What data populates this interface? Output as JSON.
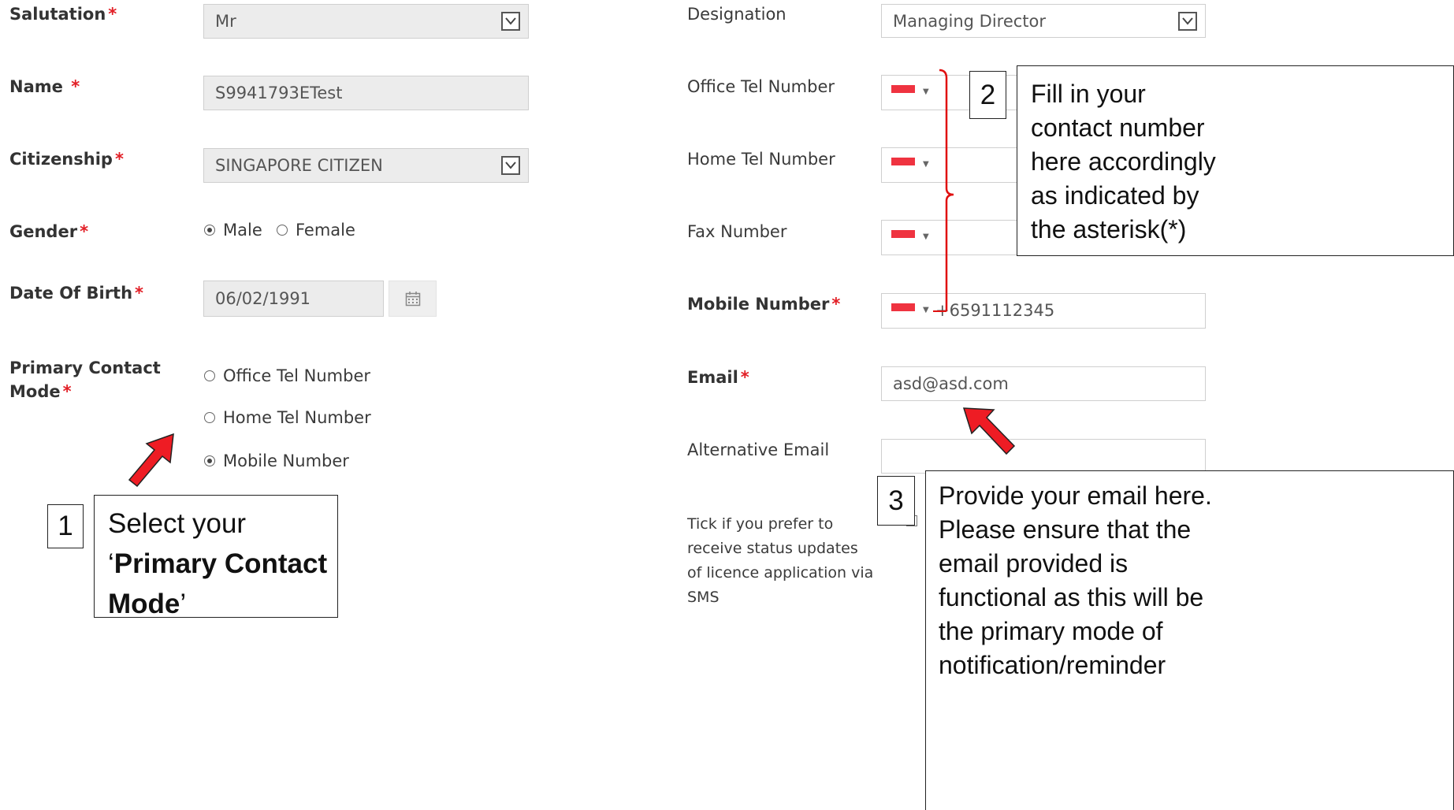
{
  "form_left": {
    "salutation": {
      "label": "Salutation",
      "value": "Mr"
    },
    "name": {
      "label": "Name",
      "value": "S9941793ETest"
    },
    "citizenship": {
      "label": "Citizenship",
      "value": "SINGAPORE CITIZEN"
    },
    "gender": {
      "label": "Gender",
      "options": [
        "Male",
        "Female"
      ],
      "selected": "Male"
    },
    "dob": {
      "label": "Date Of Birth",
      "value": "06/02/1991"
    },
    "primary_contact_mode": {
      "label_line1": "Primary Contact",
      "label_line2": "Mode",
      "options": [
        "Office Tel Number",
        "Home Tel Number",
        "Mobile Number"
      ],
      "selected": "Mobile Number"
    }
  },
  "form_right": {
    "designation": {
      "label": "Designation",
      "value": "Managing Director"
    },
    "office_tel": {
      "label": "Office Tel Number",
      "value": ""
    },
    "home_tel": {
      "label": "Home Tel Number",
      "value": ""
    },
    "fax": {
      "label": "Fax Number",
      "value": ""
    },
    "mobile": {
      "label": "Mobile Number",
      "value": "+6591112345"
    },
    "email": {
      "label": "Email",
      "value": "asd@asd.com"
    },
    "alt_email": {
      "label": "Alternative Email",
      "value": ""
    },
    "sms_pref": {
      "label_lines": [
        "Tick if you prefer to",
        "receive status updates",
        "of licence application via",
        "SMS"
      ],
      "checked": false
    }
  },
  "required_mark": "*",
  "annotations": {
    "one": {
      "number": "1",
      "line1": "Select your",
      "quote_open": "‘",
      "bold1": "Primary Contact",
      "bold2": "Mode",
      "quote_close": "’"
    },
    "two": {
      "number": "2",
      "lines": [
        "Fill in your",
        "contact number",
        "here accordingly",
        "as indicated by",
        "the asterisk(*)"
      ]
    },
    "three": {
      "number": "3",
      "lines": [
        "Provide your email here.",
        "Please ensure that the",
        "email provided is",
        "functional as this will be",
        "the primary mode of",
        "notification/reminder"
      ]
    }
  },
  "colors": {
    "required": "#e21f26",
    "arrow": "#ee1c24",
    "bracket": "#e01010",
    "flag_red": "#ef3340"
  },
  "icons": [
    "dropdown-arrow-icon",
    "calendar-icon",
    "singapore-flag-icon",
    "up-right-arrow-icon",
    "up-left-arrow-icon"
  ]
}
